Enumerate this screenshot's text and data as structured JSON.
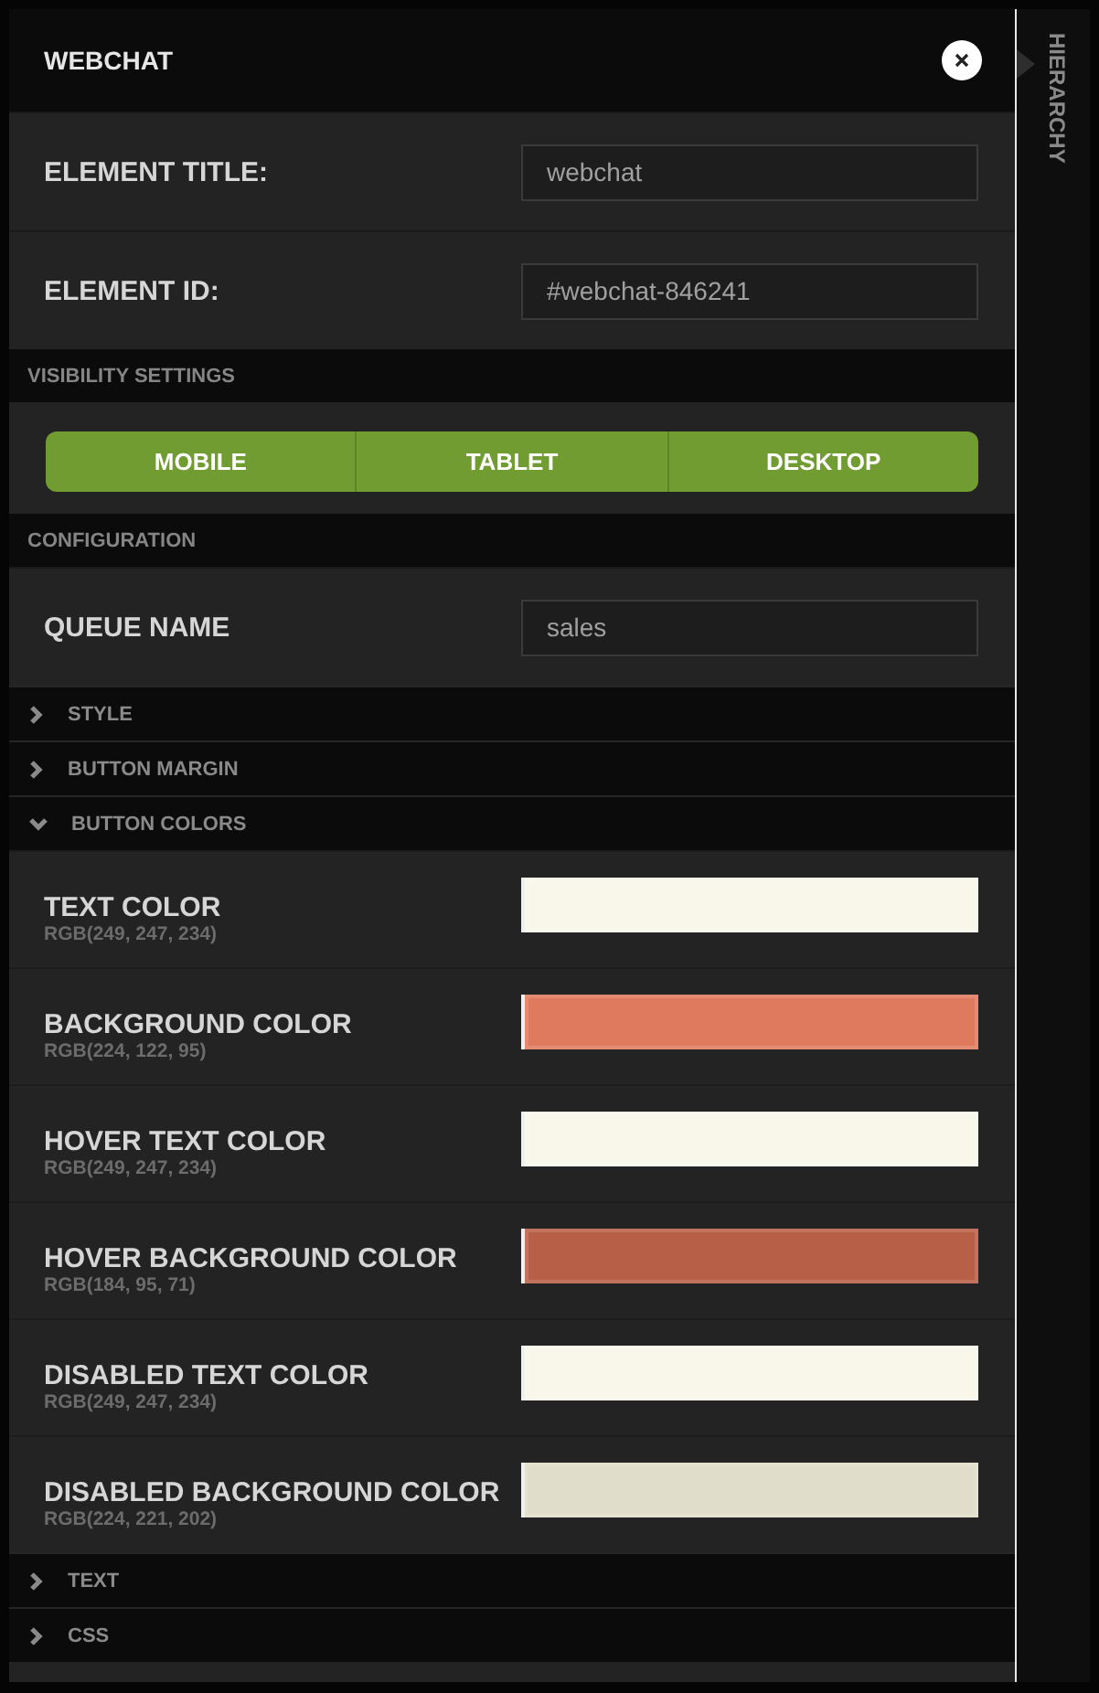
{
  "panel": {
    "title": "WEBCHAT"
  },
  "sidebar": {
    "tab": "HIERARCHY"
  },
  "sections": [
    {
      "kind": "field",
      "label": "ELEMENT TITLE:",
      "value": "webchat"
    },
    {
      "kind": "field",
      "label": "ELEMENT ID:",
      "value": "#webchat-846241"
    },
    {
      "kind": "heading",
      "label": "VISIBILITY SETTINGS"
    },
    {
      "kind": "toggles",
      "options": [
        {
          "label": "MOBILE",
          "selected": true
        },
        {
          "label": "TABLET",
          "selected": true
        },
        {
          "label": "DESKTOP",
          "selected": true
        }
      ]
    },
    {
      "kind": "heading",
      "label": "CONFIGURATION"
    },
    {
      "kind": "field",
      "label": "QUEUE NAME",
      "value": "sales"
    },
    {
      "kind": "group",
      "label": "STYLE",
      "expanded": false
    },
    {
      "kind": "group",
      "label": "BUTTON MARGIN",
      "expanded": false
    },
    {
      "kind": "group",
      "label": "BUTTON COLORS",
      "expanded": true,
      "children": [
        {
          "label": "TEXT COLOR",
          "value": "RGB(249, 247, 234)",
          "color": "#f9f7ea"
        },
        {
          "label": "BACKGROUND COLOR",
          "value": "RGB(224, 122, 95)",
          "color": "#e07a5f"
        },
        {
          "label": "HOVER TEXT COLOR",
          "value": "RGB(249, 247, 234)",
          "color": "#f9f7ea"
        },
        {
          "label": "HOVER BACKGROUND COLOR",
          "value": "RGB(184, 95, 71)",
          "color": "#b85f47"
        },
        {
          "label": "DISABLED TEXT COLOR",
          "value": "RGB(249, 247, 234)",
          "color": "#f9f7ea"
        },
        {
          "label": "DISABLED BACKGROUND COLOR",
          "value": "RGB(224, 221, 202)",
          "color": "#e0ddca"
        }
      ]
    },
    {
      "kind": "group",
      "label": "TEXT",
      "expanded": false
    },
    {
      "kind": "group",
      "label": "CSS",
      "expanded": false
    }
  ]
}
